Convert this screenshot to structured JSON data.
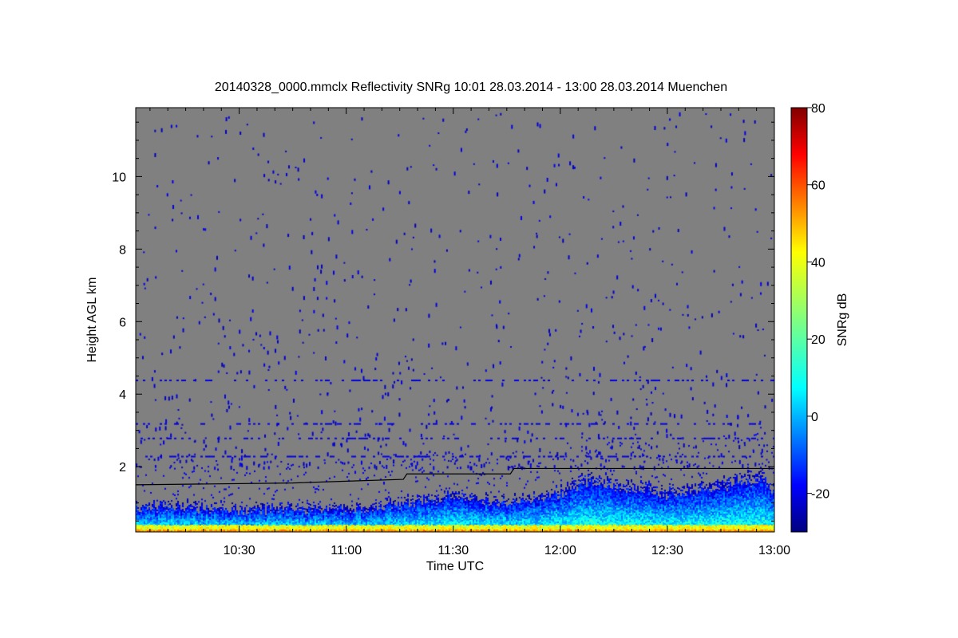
{
  "chart_data": {
    "type": "heatmap",
    "title": "20140328_0000.mmclx Reflectivity SNRg   10:01 28.03.2014 - 13:00 28.03.2014 Muenchen",
    "xlabel": "Time UTC",
    "ylabel": "Height AGL km",
    "colorbar_label": "SNRg dB",
    "xlim": [
      "10:01",
      "13:00"
    ],
    "x_ticks": [
      "10:30",
      "11:00",
      "11:30",
      "12:00",
      "12:30",
      "13:00"
    ],
    "ylim": [
      0.2,
      11.9
    ],
    "y_ticks": [
      2,
      4,
      6,
      8,
      10
    ],
    "colorbar_range": [
      -30,
      80
    ],
    "colorbar_ticks": [
      -20,
      0,
      20,
      40,
      60,
      80
    ],
    "colormap": "jet",
    "background_color": "#808080",
    "no_signal_color": "#808080",
    "grid": false,
    "legend": "colorbar-right",
    "boundary_layer_line": {
      "color": "#000000",
      "points": [
        [
          "10:01",
          1.5
        ],
        [
          "10:45",
          1.55
        ],
        [
          "11:00",
          1.6
        ],
        [
          "11:16",
          1.65
        ],
        [
          "11:17",
          1.8
        ],
        [
          "11:46",
          1.8
        ],
        [
          "11:47",
          1.95
        ],
        [
          "13:00",
          1.95
        ]
      ]
    },
    "echo_layers": [
      {
        "name_visible": false,
        "top_km_range": [
          0.6,
          1.9
        ],
        "snr_db_range": [
          -20,
          50
        ],
        "description_values": [
          [
            "10:01",
            1.0
          ],
          [
            "10:30",
            0.9
          ],
          [
            "11:00",
            0.9
          ],
          [
            "11:15",
            1.1
          ],
          [
            "11:30",
            1.3
          ],
          [
            "11:45",
            1.1
          ],
          [
            "12:00",
            1.4
          ],
          [
            "12:07",
            1.8
          ],
          [
            "12:30",
            1.4
          ],
          [
            "12:45",
            1.6
          ],
          [
            "12:57",
            1.9
          ],
          [
            "13:00",
            1.4
          ]
        ]
      }
    ],
    "clutter_bands_km": [
      4.4,
      3.2,
      2.8,
      2.3
    ]
  }
}
